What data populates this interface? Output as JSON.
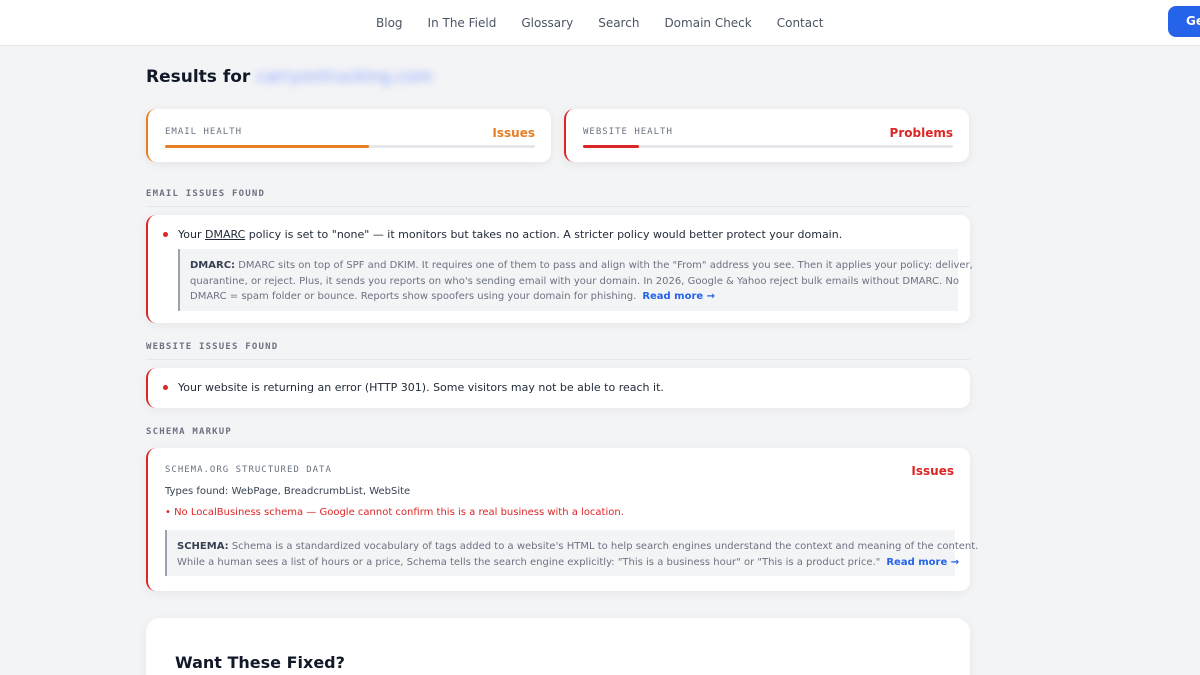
{
  "nav": {
    "links": [
      "Blog",
      "In The Field",
      "Glossary",
      "Search",
      "Domain Check",
      "Contact"
    ],
    "cta_label": "Ge"
  },
  "results": {
    "prefix": "Results for",
    "domain": "carryontrucking.com"
  },
  "email_health": {
    "label": "EMAIL HEALTH",
    "status": "Issues",
    "level_percent": 55,
    "color": "#e67e22"
  },
  "website_health": {
    "label": "WEBSITE HEALTH",
    "status": "Problems",
    "level_percent": 15,
    "color": "#dc2626"
  },
  "email_issues": {
    "heading": "EMAIL ISSUES FOUND",
    "issue": {
      "before": "Your ",
      "link": "DMARC",
      "after": " policy is set to \"none\" — it monitors but takes no action. A stricter policy would better protect your domain."
    },
    "explain": {
      "term": "DMARC:",
      "line1": "DMARC sits on top of SPF and DKIM. It requires one of them to pass and align with the \"From\" address you see. Then it applies your policy: deliver,",
      "line2": "quarantine, or reject. Plus, it sends you reports on who's sending email with your domain. In 2026, Google & Yahoo reject bulk emails without DMARC. No",
      "line3": "DMARC = spam folder or bounce. Reports show spoofers using your domain for phishing.",
      "read_more": "Read more →"
    }
  },
  "website_issues": {
    "heading": "WEBSITE ISSUES FOUND",
    "issue": "Your website is returning an error (HTTP 301). Some visitors may not be able to reach it."
  },
  "schema": {
    "heading": "SCHEMA MARKUP",
    "card_title": "SCHEMA.ORG STRUCTURED DATA",
    "status": "Issues",
    "types": "Types found: WebPage, BreadcrumbList, WebSite",
    "warning": "• No LocalBusiness schema — Google cannot confirm this is a real business with a location.",
    "explain": {
      "term": "SCHEMA:",
      "line1": "Schema is a standardized vocabulary of tags added to a website's HTML to help search engines understand the context and meaning of the content.",
      "line2": "While a human sees a list of hours or a price, Schema tells the search engine explicitly: \"This is a business hour\" or \"This is a product price.\"",
      "read_more": "Read more →"
    }
  },
  "cta": {
    "title": "Want These Fixed?"
  }
}
